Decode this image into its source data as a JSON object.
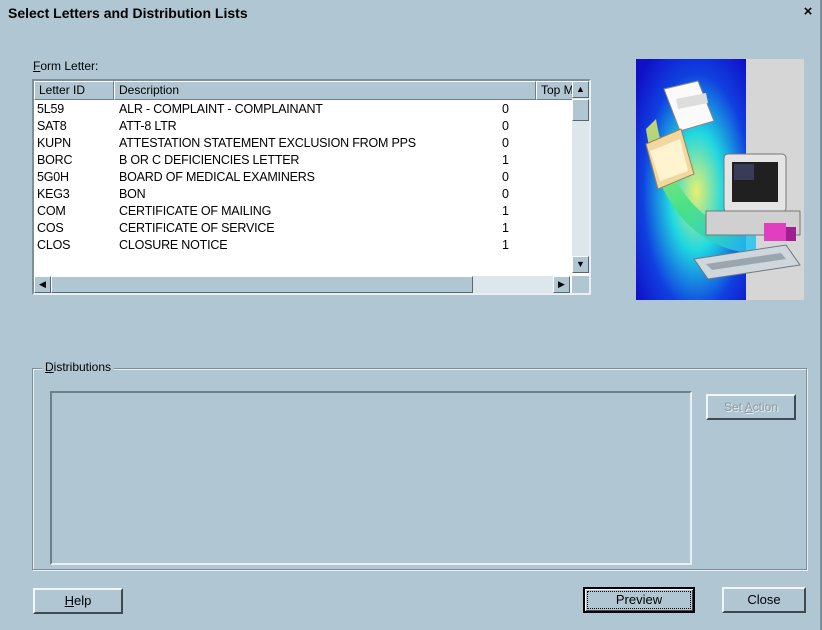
{
  "window": {
    "title": "Select Letters and Distribution Lists",
    "close_glyph": "×"
  },
  "form_letter": {
    "label_key": "F",
    "label_rest": "orm Letter:",
    "columns": [
      "Letter ID",
      "Description",
      "Top Margin"
    ],
    "rows": [
      {
        "id": "5L59",
        "description": "ALR - COMPLAINT - COMPLAINANT",
        "top_margin": "0"
      },
      {
        "id": "SAT8",
        "description": "ATT-8 LTR",
        "top_margin": "0"
      },
      {
        "id": "KUPN",
        "description": "ATTESTATION STATEMENT EXCLUSION FROM PPS",
        "top_margin": "0"
      },
      {
        "id": "BORC",
        "description": "B OR C DEFICIENCIES LETTER",
        "top_margin": "1"
      },
      {
        "id": "5G0H",
        "description": "BOARD OF MEDICAL EXAMINERS",
        "top_margin": "0"
      },
      {
        "id": "KEG3",
        "description": "BON",
        "top_margin": "0"
      },
      {
        "id": "COM",
        "description": "CERTIFICATE OF MAILING",
        "top_margin": "1"
      },
      {
        "id": "COS",
        "description": "CERTIFICATE OF SERVICE",
        "top_margin": "1"
      },
      {
        "id": "CLOS",
        "description": "CLOSURE NOTICE",
        "top_margin": "1"
      }
    ]
  },
  "distributions": {
    "label_key": "D",
    "label_rest": "istributions",
    "set_action_pre": "Set ",
    "set_action_key": "A",
    "set_action_post": "ction"
  },
  "buttons": {
    "help_key": "H",
    "help_rest": "elp",
    "preview": "Preview",
    "close": "Close"
  },
  "colors": {
    "dialog_bg": "#b0c6d2",
    "list_bg": "#ffffff"
  }
}
